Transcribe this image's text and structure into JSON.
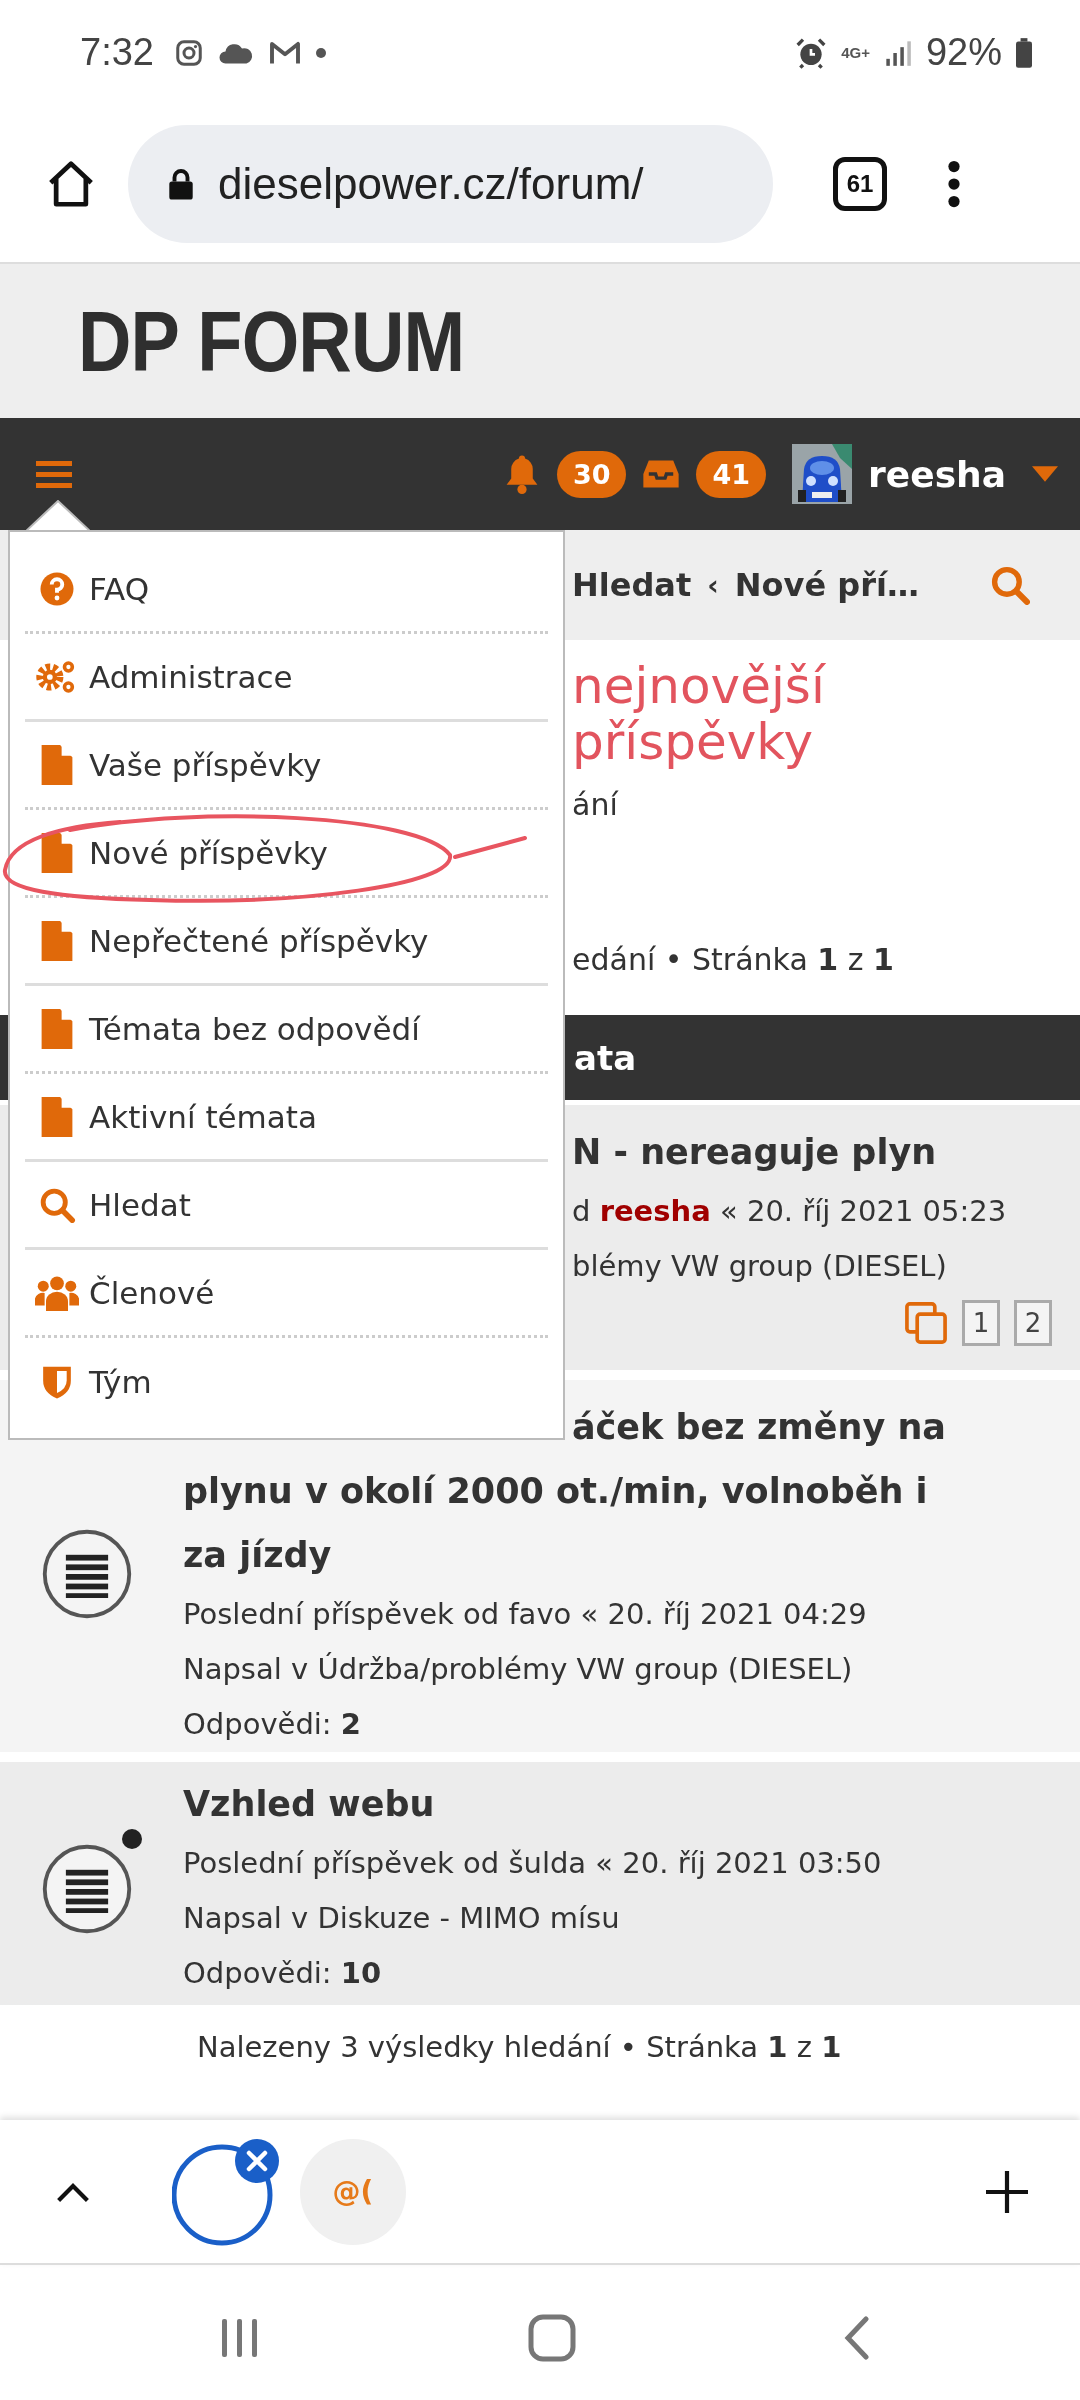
{
  "status_bar": {
    "time": "7:32",
    "network": "4G+",
    "battery": "92%"
  },
  "browser": {
    "url": "dieselpower.cz/forum/",
    "tab_count": "61"
  },
  "site": {
    "logo": "DP FORUM"
  },
  "navbar": {
    "notifications": "30",
    "messages": "41",
    "username": "reesha"
  },
  "breadcrumb": {
    "items": [
      {
        "label": "Hledat"
      },
      {
        "label": "Nové pří…"
      }
    ],
    "separator": "‹"
  },
  "annotation": {
    "text": "nejnovější příspěvky"
  },
  "search_info": {
    "fragment": "ání",
    "summary": "edání • Stránka **1** z **1**"
  },
  "section_header": {
    "title": "ata"
  },
  "partial_topic": {
    "title": "N - nereaguje plyn",
    "meta": {
      "prefix": "d",
      "author": "reesha",
      "own": true,
      "suffix": "« 20. říj 2021 05:23"
    },
    "forum": "blémy VW group (DIESEL)",
    "pages": [
      "1",
      "2"
    ]
  },
  "topics": [
    {
      "title_lines": [
        "áček bez změny na",
        "plynu v okolí 2000 ot./min, volnoběh i",
        "za jízdy"
      ],
      "meta": {
        "prefix": "Poslední příspěvek od",
        "author": "favo",
        "own": false,
        "suffix": "« 20. říj 2021 04:29"
      },
      "forum": "Napsal v Údržba/problémy VW group (DIESEL)",
      "replies": "Odpovědi: **2**",
      "unread": false
    },
    {
      "title_lines": [
        "Vzhled webu"
      ],
      "meta": {
        "prefix": "Poslední příspěvek od",
        "author": "šulda",
        "own": false,
        "suffix": "« 20. říj 2021 03:50"
      },
      "forum": "Napsal v Diskuze - MIMO mísu",
      "replies": "Odpovědi: **10**",
      "unread": true
    }
  ],
  "footer": {
    "summary": "Nalezeny 3 výsledky hledání • Stránka **1** z **1**"
  },
  "menu": {
    "items": [
      {
        "label": "FAQ",
        "kind": "help",
        "solid_divider": false
      },
      {
        "label": "Administrace",
        "kind": "admin",
        "solid_divider": true
      },
      {
        "label": "Vaše příspěvky",
        "kind": "page",
        "solid_divider": false
      },
      {
        "label": "Nové příspěvky",
        "kind": "page",
        "solid_divider": false
      },
      {
        "label": "Nepřečtené příspěvky",
        "kind": "page",
        "solid_divider": true
      },
      {
        "label": "Témata bez odpovědí",
        "kind": "page",
        "solid_divider": false
      },
      {
        "label": "Aktivní témata",
        "kind": "page",
        "solid_divider": true
      },
      {
        "label": "Hledat",
        "kind": "search",
        "solid_divider": true
      },
      {
        "label": "Členové",
        "kind": "members",
        "solid_divider": false
      },
      {
        "label": "Tým",
        "kind": "team"
      }
    ]
  },
  "bottom_toolbar": {
    "tab_label": "@("
  }
}
